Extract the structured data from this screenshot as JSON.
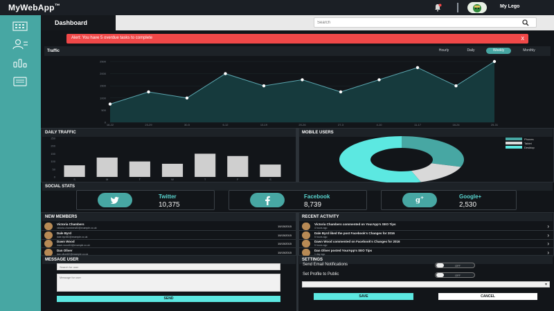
{
  "app": {
    "brand": "MyWebApp",
    "brand_tm": "™",
    "username": "My Lego"
  },
  "nav": {
    "active_tab": "Dashboard"
  },
  "search": {
    "placeholder": "Search"
  },
  "alert": {
    "text": "Alert: You have 5 overdue tasks to complete",
    "close": "x"
  },
  "traffic": {
    "title": "Traffic",
    "ranges": [
      "Hourly",
      "Daily",
      "Weekly",
      "Monthly"
    ],
    "active_range": "Weekly",
    "y_ticks": [
      "2500",
      "2000",
      "1500",
      "1000",
      "500",
      "0"
    ],
    "x_ticks": [
      "16-22",
      "23-29",
      "30-5",
      "6-12",
      "13-19",
      "20-26",
      "27-3",
      "4-10",
      "11-17",
      "18-24",
      "25-31"
    ]
  },
  "daily_traffic": {
    "title": "DAILY TRAFFIC",
    "y_ticks": [
      "250",
      "200",
      "150",
      "100",
      "50",
      "0"
    ],
    "x_ticks": [
      "S",
      "M",
      "T",
      "W",
      "T",
      "F",
      "S"
    ]
  },
  "mobile_users": {
    "title": "MOBILE USERS",
    "legend": [
      "Phones",
      "Tablet",
      "Desktop"
    ]
  },
  "social": {
    "title": "SOCIAL STATS",
    "items": [
      {
        "name": "Twitter",
        "count": "10,375"
      },
      {
        "name": "Facebook",
        "count": "8,739"
      },
      {
        "name": "Google+",
        "count": "2,530"
      }
    ]
  },
  "members": {
    "title": "NEW MEMBERS",
    "rows": [
      {
        "name": "Victoria Chambers",
        "email": "victoria.chambers80@example.co.uk",
        "date": "10/15/2015"
      },
      {
        "name": "Dale Byrd",
        "email": "dale.byrd52@example.co.uk",
        "date": "10/15/2015"
      },
      {
        "name": "Dawn Wood",
        "email": "dawn.wood16@example.co.uk",
        "date": "10/15/2015"
      },
      {
        "name": "Dan Oliver",
        "email": "dan.oliver82@example.co.uk",
        "date": "10/15/2015"
      }
    ]
  },
  "activity": {
    "title": "RECENT ACTIVITY",
    "rows": [
      {
        "text": "Victoria Chambers commented on YourApp's SEO Tips",
        "time": "4 hours ago"
      },
      {
        "text": "Dale Byrd liked the post Facebook's Changes for 2016",
        "time": "5 hours ago"
      },
      {
        "text": "Dawn Wood commented on Facebook's Changes for 2016",
        "time": "5 hours ago"
      },
      {
        "text": "Dan Oliver posted YourApp's SEO Tips",
        "time": "1 day ago"
      }
    ],
    "arrow": "›"
  },
  "message": {
    "title": "MESSAGE USER",
    "search_placeholder": "Search for user",
    "message_placeholder": "Message for user",
    "send": "SEND"
  },
  "settings": {
    "title": "SETTINGS",
    "email_label": "Send Email Notifications",
    "email_state": "OFF",
    "public_label": "Set Profile to Public",
    "public_state": "OFF",
    "save": "SAVE",
    "cancel": "CANCEL"
  },
  "chart_data": [
    {
      "type": "area",
      "title": "Traffic",
      "x": [
        "16-22",
        "23-29",
        "30-5",
        "6-12",
        "13-19",
        "20-26",
        "27-3",
        "4-10",
        "11-17",
        "18-24",
        "25-31"
      ],
      "values": [
        750,
        1250,
        1000,
        2000,
        1500,
        1750,
        1250,
        1750,
        2250,
        1500,
        2500
      ],
      "ylim": [
        0,
        2500
      ]
    },
    {
      "type": "bar",
      "title": "DAILY TRAFFIC",
      "categories": [
        "S",
        "M",
        "T",
        "W",
        "T",
        "F",
        "S"
      ],
      "values": [
        75,
        125,
        100,
        85,
        150,
        135,
        80
      ],
      "ylim": [
        0,
        250
      ]
    },
    {
      "type": "pie",
      "title": "MOBILE USERS",
      "categories": [
        "Phones",
        "Tablet",
        "Desktop"
      ],
      "values": [
        30,
        15,
        55
      ],
      "colors": [
        "#47a7a3",
        "#d9d9d9",
        "#5ce8e1"
      ]
    }
  ],
  "colors": {
    "sidebar": "#47a7a3",
    "accent": "#5ce8e1",
    "alert": "#f04848"
  }
}
